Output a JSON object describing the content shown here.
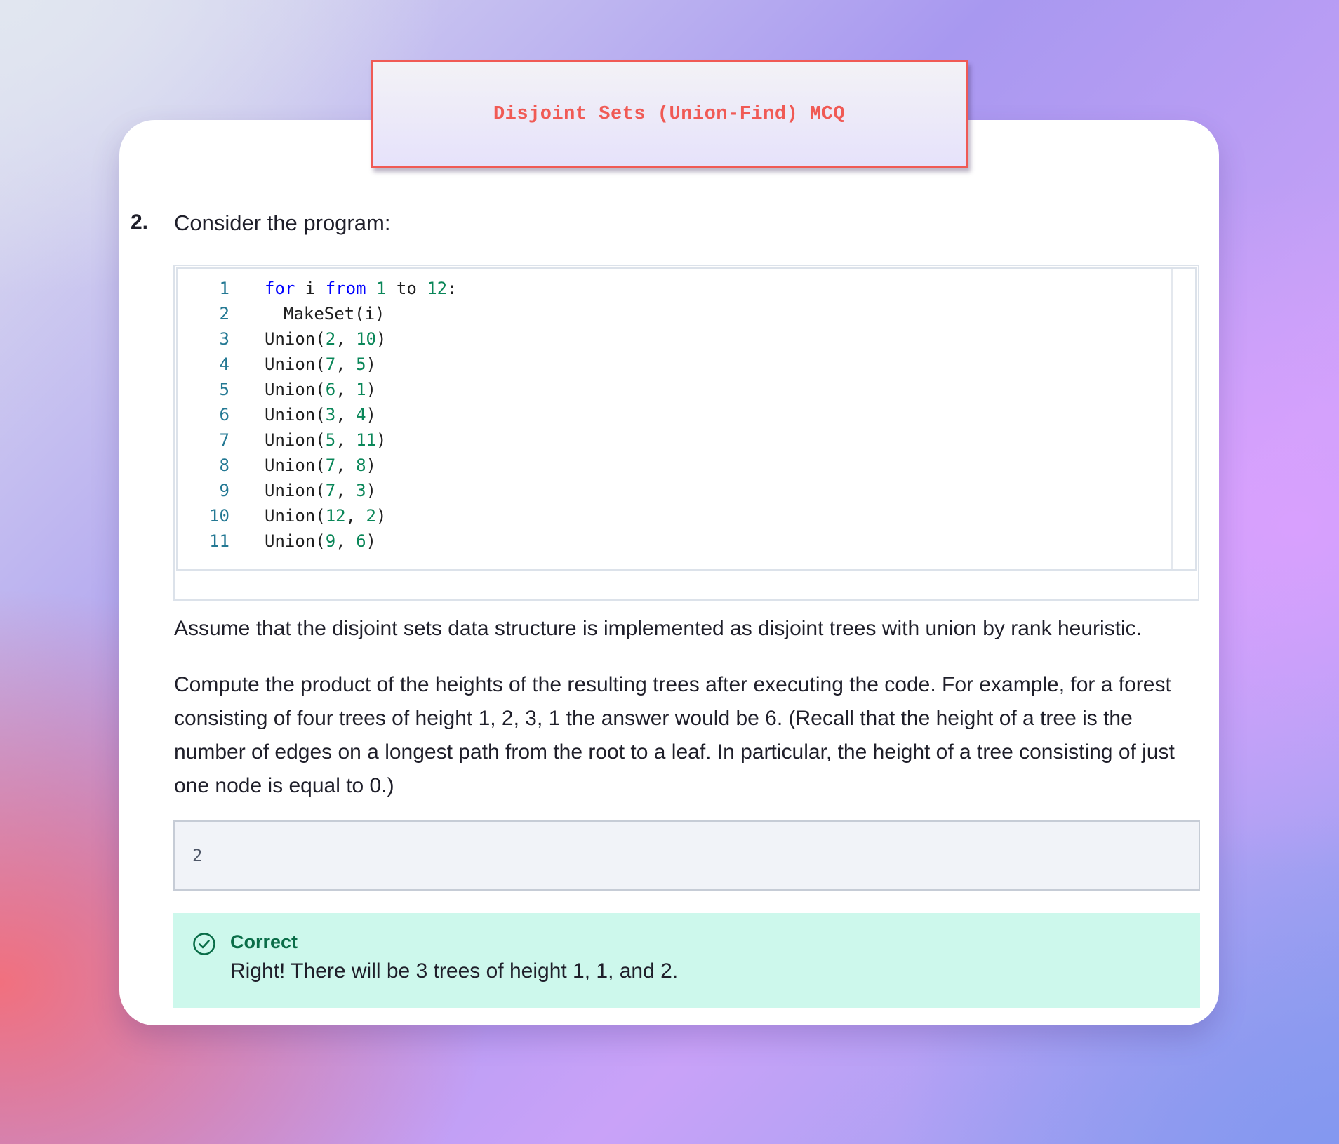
{
  "header": {
    "title": "Disjoint Sets (Union-Find) MCQ"
  },
  "question": {
    "number": "2.",
    "prompt": "Consider the program:",
    "code": {
      "lines": [
        {
          "num": "1",
          "tokens": [
            {
              "t": "for",
              "c": "kw"
            },
            {
              "t": " i ",
              "c": "plain"
            },
            {
              "t": "from",
              "c": "kw"
            },
            {
              "t": " ",
              "c": "plain"
            },
            {
              "t": "1",
              "c": "num"
            },
            {
              "t": " to ",
              "c": "plain"
            },
            {
              "t": "12",
              "c": "num"
            },
            {
              "t": ":",
              "c": "plain"
            }
          ]
        },
        {
          "num": "2",
          "indent": true,
          "tokens": [
            {
              "t": "MakeSet(i)",
              "c": "plain"
            }
          ]
        },
        {
          "num": "3",
          "tokens": [
            {
              "t": "Union(",
              "c": "plain"
            },
            {
              "t": "2",
              "c": "num"
            },
            {
              "t": ", ",
              "c": "plain"
            },
            {
              "t": "10",
              "c": "num"
            },
            {
              "t": ")",
              "c": "plain"
            }
          ]
        },
        {
          "num": "4",
          "tokens": [
            {
              "t": "Union(",
              "c": "plain"
            },
            {
              "t": "7",
              "c": "num"
            },
            {
              "t": ", ",
              "c": "plain"
            },
            {
              "t": "5",
              "c": "num"
            },
            {
              "t": ")",
              "c": "plain"
            }
          ]
        },
        {
          "num": "5",
          "tokens": [
            {
              "t": "Union(",
              "c": "plain"
            },
            {
              "t": "6",
              "c": "num"
            },
            {
              "t": ", ",
              "c": "plain"
            },
            {
              "t": "1",
              "c": "num"
            },
            {
              "t": ")",
              "c": "plain"
            }
          ]
        },
        {
          "num": "6",
          "tokens": [
            {
              "t": "Union(",
              "c": "plain"
            },
            {
              "t": "3",
              "c": "num"
            },
            {
              "t": ", ",
              "c": "plain"
            },
            {
              "t": "4",
              "c": "num"
            },
            {
              "t": ")",
              "c": "plain"
            }
          ]
        },
        {
          "num": "7",
          "tokens": [
            {
              "t": "Union(",
              "c": "plain"
            },
            {
              "t": "5",
              "c": "num"
            },
            {
              "t": ", ",
              "c": "plain"
            },
            {
              "t": "11",
              "c": "num"
            },
            {
              "t": ")",
              "c": "plain"
            }
          ]
        },
        {
          "num": "8",
          "tokens": [
            {
              "t": "Union(",
              "c": "plain"
            },
            {
              "t": "7",
              "c": "num"
            },
            {
              "t": ", ",
              "c": "plain"
            },
            {
              "t": "8",
              "c": "num"
            },
            {
              "t": ")",
              "c": "plain"
            }
          ]
        },
        {
          "num": "9",
          "tokens": [
            {
              "t": "Union(",
              "c": "plain"
            },
            {
              "t": "7",
              "c": "num"
            },
            {
              "t": ", ",
              "c": "plain"
            },
            {
              "t": "3",
              "c": "num"
            },
            {
              "t": ")",
              "c": "plain"
            }
          ]
        },
        {
          "num": "10",
          "tokens": [
            {
              "t": "Union(",
              "c": "plain"
            },
            {
              "t": "12",
              "c": "num"
            },
            {
              "t": ", ",
              "c": "plain"
            },
            {
              "t": "2",
              "c": "num"
            },
            {
              "t": ")",
              "c": "plain"
            }
          ]
        },
        {
          "num": "11",
          "tokens": [
            {
              "t": "Union(",
              "c": "plain"
            },
            {
              "t": "9",
              "c": "num"
            },
            {
              "t": ", ",
              "c": "plain"
            },
            {
              "t": "6",
              "c": "num"
            },
            {
              "t": ")",
              "c": "plain"
            }
          ]
        }
      ]
    },
    "assumption": "Assume that the disjoint sets data structure is implemented as disjoint trees with union by rank heuristic.",
    "instructions": "Compute the product of the heights of the resulting trees after executing the code. For example, for a forest consisting of four trees of height 1, 2, 3, 1 the answer would be 6. (Recall that the height of a tree is the number of edges on a longest path from the root to a leaf. In particular, the height of a tree consisting of just one node is equal to 0.)",
    "answer_value": "2"
  },
  "feedback": {
    "status": "Correct",
    "message": "Right! There will be 3 trees of height 1, 1, and 2.",
    "icon": "check-circle-icon"
  },
  "colors": {
    "title_accent": "#f05a55",
    "keyword": "#0000ff",
    "number": "#098658",
    "line_number": "#237893",
    "feedback_bg": "#cdf8ec",
    "feedback_accent": "#0a6d48"
  }
}
